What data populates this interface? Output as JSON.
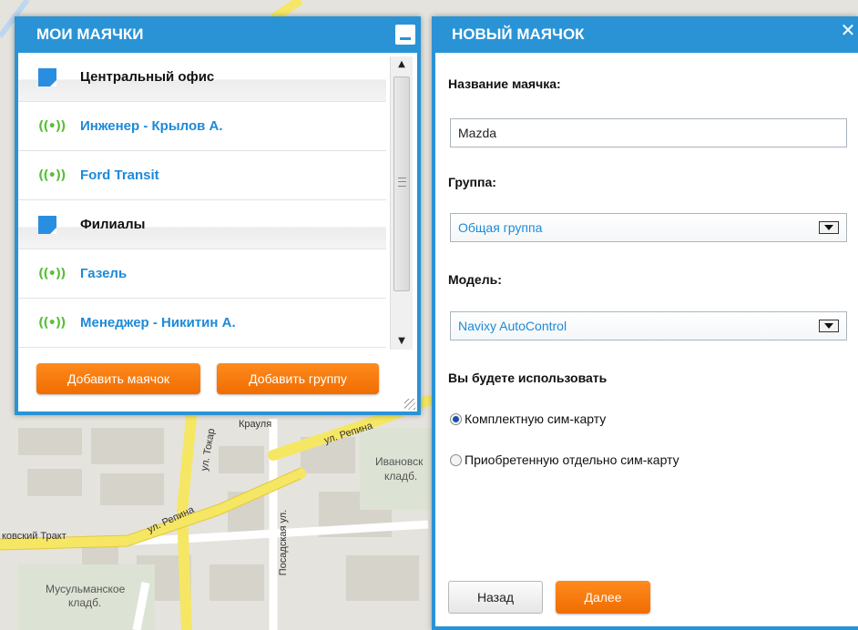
{
  "colors": {
    "accent": "#2a93d6",
    "link": "#1d8ad8",
    "orange": "#f57a0a",
    "signal": "#5bbf3a"
  },
  "map": {
    "street_labels": [
      "ул. Токар",
      "ул. Репина",
      "ул. Репина",
      "ковский Тракт",
      "Посадская ул.",
      "Крауля"
    ],
    "place_labels": [
      "Ивановск",
      "кладб.",
      "Мусульманское",
      "кладб."
    ]
  },
  "my_beacons": {
    "title": "Мои маячки",
    "minimize_icon": "minimize-icon",
    "items": [
      {
        "type": "group",
        "label": "Центральный офис",
        "icon": "folder-icon"
      },
      {
        "type": "tracker",
        "label": "Инженер - Крылов А.",
        "icon": "signal-icon"
      },
      {
        "type": "tracker",
        "label": "Ford Transit",
        "icon": "signal-icon"
      },
      {
        "type": "group",
        "label": "Филиалы",
        "icon": "folder-icon"
      },
      {
        "type": "tracker",
        "label": "Газель",
        "icon": "signal-icon"
      },
      {
        "type": "tracker",
        "label": "Менеджер - Никитин А.",
        "icon": "signal-icon"
      }
    ],
    "add_beacon_label": "Добавить маячок",
    "add_group_label": "Добавить группу"
  },
  "new_beacon": {
    "title": "Новый маячок",
    "close_icon": "close-icon",
    "name_label": "Название маячка:",
    "name_value": "Mazda",
    "group_label": "Группа:",
    "group_value": "Общая группа",
    "model_label": "Модель:",
    "model_value": "Navixy AutoControl",
    "usage_label": "Вы будете использовать",
    "sim_options": [
      {
        "label": "Комплектную сим-карту",
        "checked": true
      },
      {
        "label": "Приобретенную отдельно сим-карту",
        "checked": false
      }
    ],
    "back_label": "Назад",
    "next_label": "Далее"
  }
}
